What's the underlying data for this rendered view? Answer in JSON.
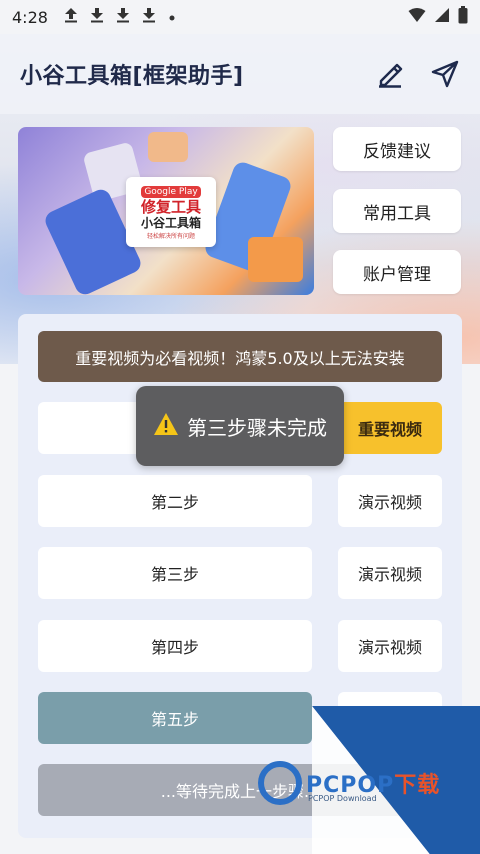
{
  "status_bar": {
    "time": "4:28",
    "notif_icons": [
      "upload-icon",
      "download-icon",
      "download-icon",
      "download-icon",
      "dot-icon"
    ]
  },
  "header": {
    "title": "小谷工具箱[框架助手]",
    "icons": [
      "edit-icon",
      "send-icon"
    ]
  },
  "banner": {
    "badge": "Google Play",
    "title": "修复工具",
    "subtitle": "小谷工具箱",
    "caption": "轻松解决所有问题"
  },
  "side_buttons": [
    "反馈建议",
    "常用工具",
    "账户管理"
  ],
  "notice": "重要视频为必看视频！鸿蒙5.0及以上无法安装",
  "steps": [
    {
      "label": "",
      "video": "重要视频"
    },
    {
      "label": "第二步",
      "video": "演示视频"
    },
    {
      "label": "第三步",
      "video": "演示视频"
    },
    {
      "label": "第四步",
      "video": "演示视频"
    },
    {
      "label": "第五步",
      "video": ""
    }
  ],
  "wait_text": "...等待完成上一步骤...",
  "toast": "第三步骤未完成",
  "watermark": {
    "brand": "PCPOP",
    "brand_cn": "下载",
    "sub": "PCPOP Download"
  },
  "colors": {
    "notice_bg": "#6e5a4b",
    "important_bg": "#f7c12c",
    "active_step_bg": "#7a9eaa",
    "wait_bg": "#a7abb5",
    "toast_bg": "#5d5d5f"
  }
}
